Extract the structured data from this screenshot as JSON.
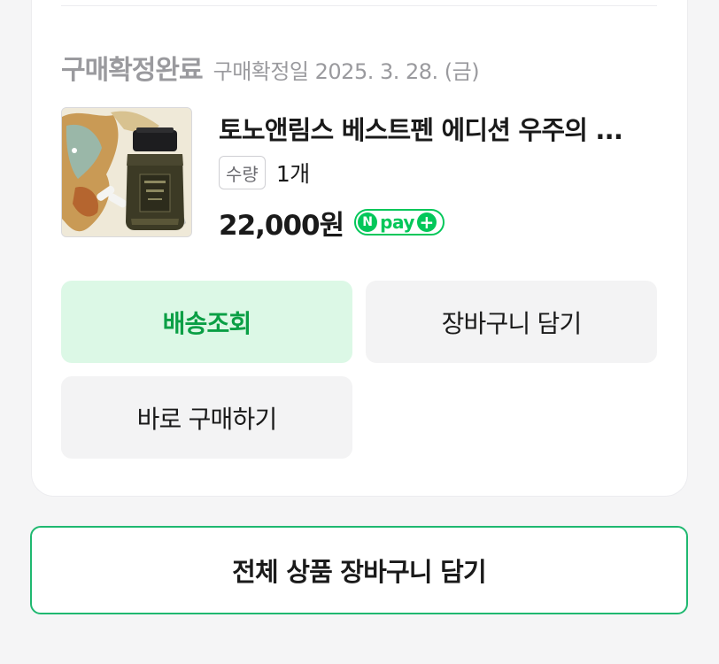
{
  "order": {
    "status_label": "구매확정완료",
    "confirm_date": "구매확정일 2025. 3. 28. (금)"
  },
  "product": {
    "title": "토노앤림스 베스트펜 에디션 우주의 ...",
    "thumbnail_icon": "ink-bottle-thumbnail",
    "quantity_label": "수량",
    "quantity_value": "1개",
    "price": "22,000원",
    "pay_badge": {
      "n": "N",
      "text": "pay",
      "plus": "+"
    }
  },
  "buttons": {
    "track_delivery": "배송조회",
    "add_to_cart": "장바구니 담기",
    "buy_now": "바로 구매하기",
    "add_all_to_cart": "전체 상품 장바구니 담기"
  },
  "colors": {
    "brand_green": "#03c75a",
    "track_button_bg": "#dcf8e6",
    "track_button_text": "#0a9f45",
    "neutral_button_bg": "#f3f3f4"
  }
}
